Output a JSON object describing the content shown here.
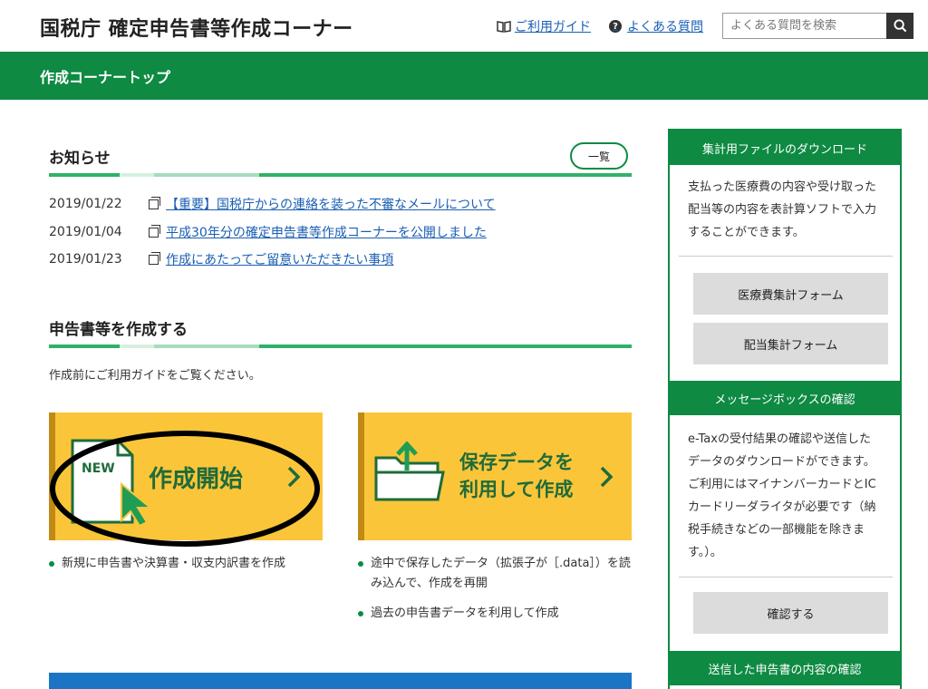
{
  "header": {
    "site_title": "国税庁 確定申告書等作成コーナー",
    "guide_link": "ご利用ガイド",
    "faq_link": "よくある質問",
    "search_placeholder": "よくある質問を検索"
  },
  "nav": {
    "title": "作成コーナートップ"
  },
  "news": {
    "title": "お知らせ",
    "list_button": "一覧",
    "items": [
      {
        "date": "2019/01/22",
        "text": "【重要】国税庁からの連絡を装った不審なメールについて"
      },
      {
        "date": "2019/01/04",
        "text": "平成30年分の確定申告書等作成コーナーを公開しました"
      },
      {
        "date": "2019/01/23",
        "text": "作成にあたってご留意いただきたい事項"
      }
    ]
  },
  "create": {
    "title": "申告書等を作成する",
    "intro": "作成前にご利用ガイドをご覧ください。",
    "new_card": {
      "badge": "NEW",
      "label": "作成開始"
    },
    "saved_card": {
      "label_line1": "保存データを",
      "label_line2": "利用して作成"
    },
    "new_bullets": [
      "新規に申告書や決算書・収支内訳書を作成"
    ],
    "saved_bullets": [
      "途中で保存したデータ（拡張子が［.data］）を読み込んで、作成を再開",
      "過去の申告書データを利用して作成"
    ]
  },
  "sidebar": {
    "download": {
      "heading": "集計用ファイルのダウンロード",
      "text": "支払った医療費の内容や受け取った配当等の内容を表計算ソフトで入力することができます。",
      "button1": "医療費集計フォーム",
      "button2": "配当集計フォーム"
    },
    "messagebox": {
      "heading": "メッセージボックスの確認",
      "text": "e-Taxの受付結果の確認や送信したデータのダウンロードができます。ご利用にはマイナンバーカードとICカードリーダライタが必要です（納税手続きなどの一部機能を除きます。）。",
      "button": "確認する"
    },
    "sent": {
      "heading": "送信した申告書の内容の確認"
    }
  },
  "colors": {
    "brand_green": "#0e8a43",
    "card_yellow": "#fbc53a",
    "link_blue": "#1a5fb4"
  }
}
